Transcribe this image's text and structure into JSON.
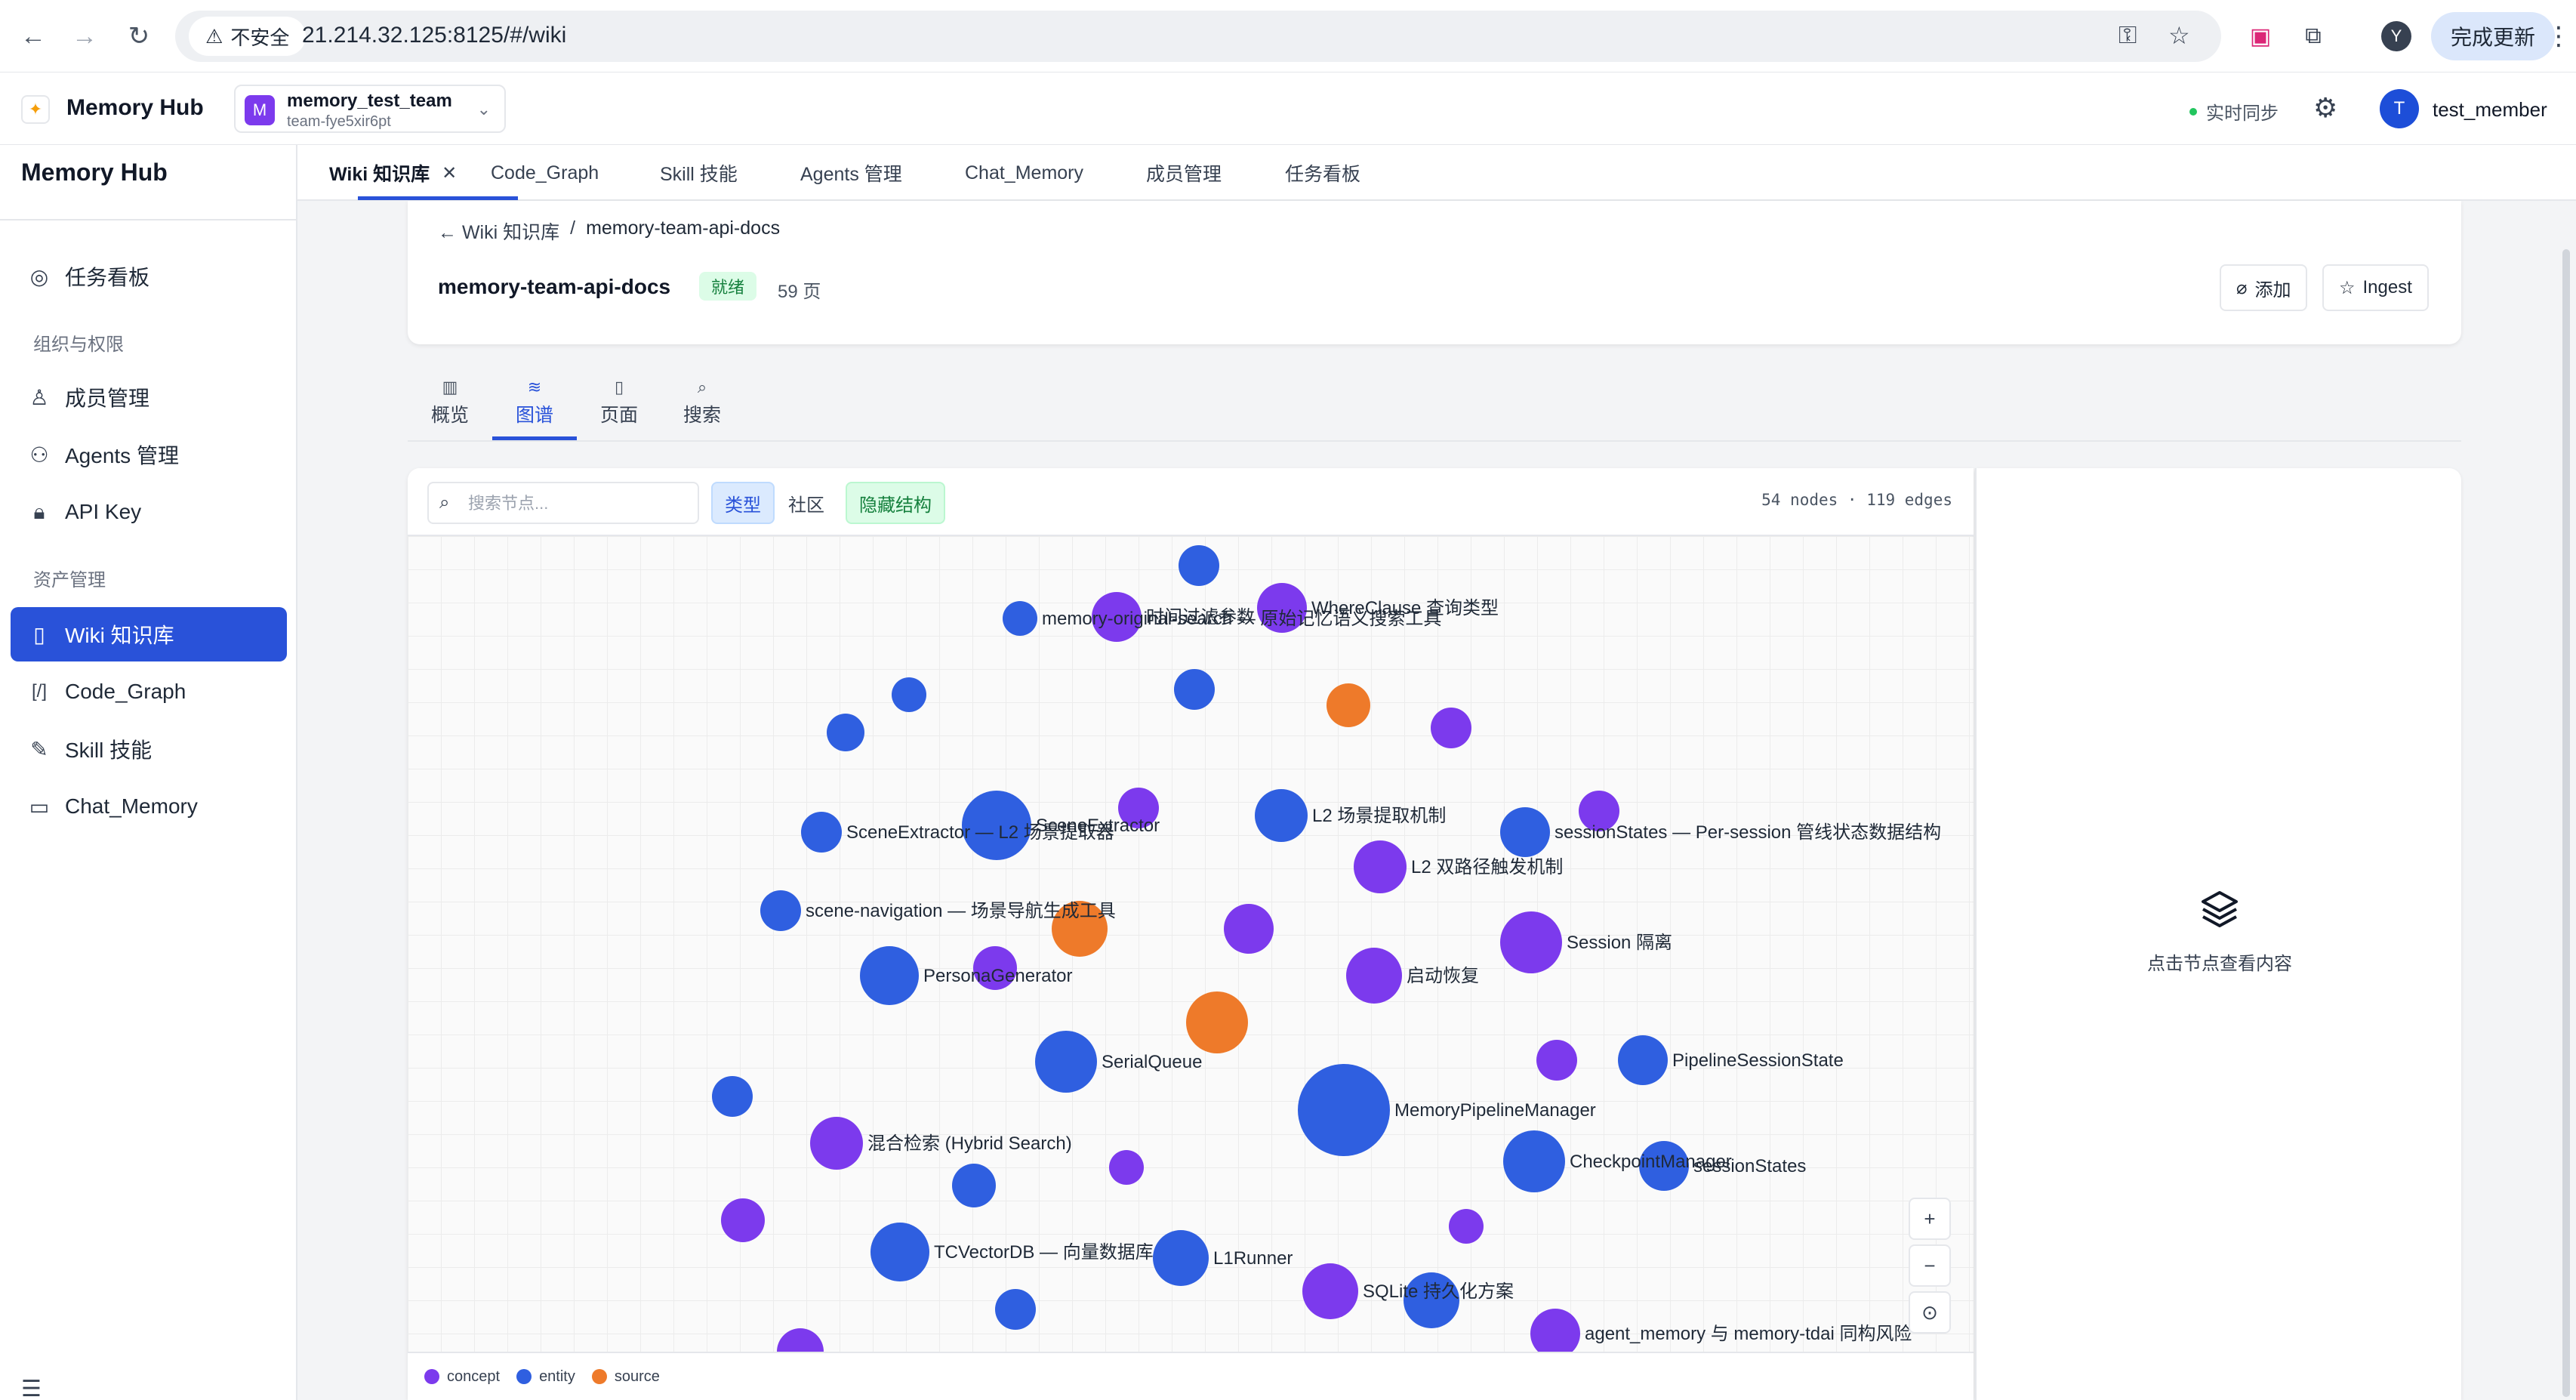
{
  "browser": {
    "insecure_label": "不安全",
    "url": "21.214.32.125:8125/#/wiki",
    "profile_initial": "Y",
    "update_label": "完成更新"
  },
  "app": {
    "brand": "Memory Hub",
    "team_initial": "M",
    "team_name": "memory_test_team",
    "team_id": "team-fye5xir6pt",
    "sync_label": "实时同步",
    "user_initial": "T",
    "user_name": "test_member"
  },
  "sidebar": {
    "title": "Memory Hub",
    "items": [
      {
        "label": "任务看板",
        "icon": "target-icon"
      },
      {
        "label": "成员管理",
        "icon": "user-icon"
      },
      {
        "label": "Agents 管理",
        "icon": "users-icon"
      },
      {
        "label": "API Key",
        "icon": "lock-icon"
      },
      {
        "label": "Wiki 知识库",
        "icon": "bookmark-icon"
      },
      {
        "label": "Code_Graph",
        "icon": "code-icon"
      },
      {
        "label": "Skill 技能",
        "icon": "wand-icon"
      },
      {
        "label": "Chat_Memory",
        "icon": "chat-icon"
      }
    ],
    "groups": [
      "组织与权限",
      "资产管理"
    ]
  },
  "tabs": [
    "Wiki 知识库",
    "Code_Graph",
    "Skill 技能",
    "Agents 管理",
    "Chat_Memory",
    "成员管理",
    "任务看板"
  ],
  "header": {
    "back_label": "← Wiki 知识库",
    "separator": "/",
    "current": "memory-team-api-docs",
    "title": "memory-team-api-docs",
    "status": "就绪",
    "pages": "59 页",
    "add_label": "添加",
    "ingest_label": "Ingest"
  },
  "view_tabs": [
    {
      "label": "概览",
      "icon": "bar-chart-icon"
    },
    {
      "label": "图谱",
      "icon": "layers-icon"
    },
    {
      "label": "页面",
      "icon": "file-icon"
    },
    {
      "label": "搜索",
      "icon": "search-icon"
    }
  ],
  "graph": {
    "search_placeholder": "搜索节点...",
    "filter_type": "类型",
    "filter_community": "社区",
    "hide_structure": "隐藏结构",
    "stats": "54 nodes · 119 edges",
    "legend": [
      {
        "label": "concept",
        "color": "#7c3aed"
      },
      {
        "label": "entity",
        "color": "#2f5fe0"
      },
      {
        "label": "source",
        "color": "#ee7a2a"
      }
    ],
    "nodes": [
      {
        "type": "entity"
      },
      {
        "type": "entity",
        "label": "memory-original-search — 原始记忆语义搜索工具"
      },
      {
        "type": "concept",
        "label": "时间过滤参数"
      },
      {
        "type": "concept",
        "label": "WhereClause 查询类型"
      },
      {
        "type": "entity"
      },
      {
        "type": "source"
      },
      {
        "type": "concept"
      },
      {
        "type": "entity"
      },
      {
        "type": "entity"
      },
      {
        "type": "entity",
        "label": "SceneExtractor — L2 场景提取器"
      },
      {
        "type": "entity",
        "label": "SceneExtractor"
      },
      {
        "type": "concept"
      },
      {
        "type": "entity",
        "label": "L2 场景提取机制"
      },
      {
        "type": "concept",
        "label": "L2 双路径触发机制"
      },
      {
        "type": "entity",
        "label": "sessionStates — Per-session 管线状态数据结构"
      },
      {
        "type": "concept"
      },
      {
        "type": "entity",
        "label": "scene-navigation — 场景导航生成工具"
      },
      {
        "type": "source"
      },
      {
        "type": "concept"
      },
      {
        "type": "concept",
        "label": "Session 隔离"
      },
      {
        "type": "entity",
        "label": "PersonaGenerator"
      },
      {
        "type": "concept"
      },
      {
        "type": "concept",
        "label": "启动恢复"
      },
      {
        "type": "source"
      },
      {
        "type": "entity",
        "label": "SerialQueue"
      },
      {
        "type": "concept"
      },
      {
        "type": "entity",
        "label": "PipelineSessionState"
      },
      {
        "type": "entity",
        "label": "MemoryPipelineManager"
      },
      {
        "type": "entity"
      },
      {
        "type": "concept",
        "label": "混合检索 (Hybrid Search)"
      },
      {
        "type": "entity",
        "label": "CheckpointManager"
      },
      {
        "type": "entity",
        "label": "sessionStates"
      },
      {
        "type": "entity"
      },
      {
        "type": "concept"
      },
      {
        "type": "concept"
      },
      {
        "type": "concept"
      },
      {
        "type": "entity",
        "label": "TCVectorDB — 向量数据库"
      },
      {
        "type": "entity",
        "label": "L1Runner"
      },
      {
        "type": "concept",
        "label": "SQLite 持久化方案"
      },
      {
        "type": "entity"
      },
      {
        "type": "entity"
      },
      {
        "type": "concept",
        "label": "agent_memory 与 memory-tdai 同构风险"
      },
      {
        "type": "concept"
      }
    ],
    "zoom": {
      "in": "+",
      "out": "−",
      "fit": "⊙"
    }
  },
  "detail": {
    "empty_text": "点击节点查看内容",
    "icon": "layers-icon"
  }
}
